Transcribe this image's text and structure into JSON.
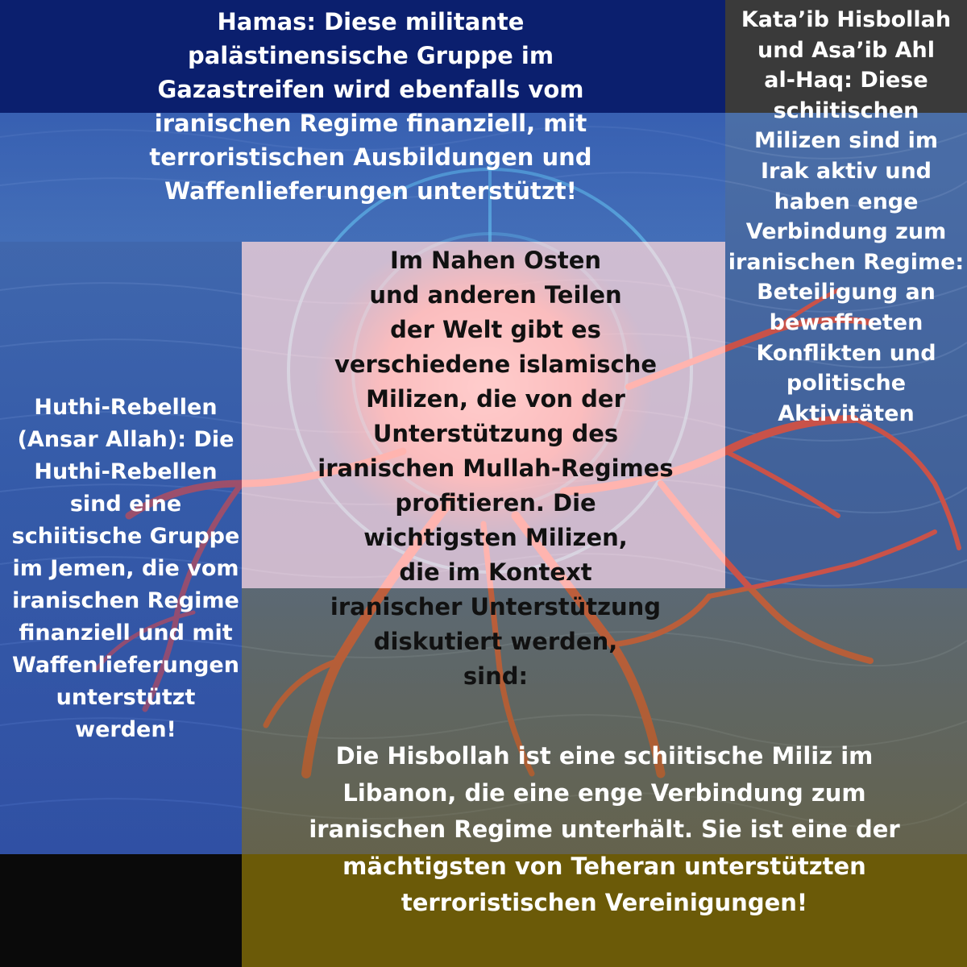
{
  "hamas": {
    "text": "Hamas: Diese militante\npalästinensische Gruppe im\nGazastreifen wird ebenfalls vom\niranischen Regime finanziell, mit\nterroristischen Ausbildungen und\nWaffenlieferungen unterstützt!"
  },
  "kataib": {
    "text": "Kata’ib Hisbollah\nund Asa’ib Ahl\nal-Haq: Diese\nschiitischen\nMilizen sind im\nIrak aktiv und\nhaben enge\nVerbindung zum\niranischen Regime:\nBeteiligung an\nbewaffneten\nKonflikten und\npolitische Aktivitäten"
  },
  "intro": {
    "text": "Im Nahen Osten\nund anderen Teilen\nder Welt gibt es\nverschiedene islamische\nMilizen, die von der\nUnterstützung des\niranischen Mullah-Regimes\nprofitieren. Die\nwichtigsten Milizen,\ndie im Kontext\niranischer Unterstützung\ndiskutiert werden,\nsind:"
  },
  "huthi": {
    "text": "Huthi-Rebellen\n(Ansar Allah): Die\nHuthi-Rebellen\nsind eine\nschiitische Gruppe\nim Jemen, die vom\niranischen Regime\nfinanziell und mit\nWaffenlieferungen\nunterstützt\nwerden!"
  },
  "hisbollah": {
    "text": "Die Hisbollah ist eine schiitische Miliz im\nLibanon, die eine enge Verbindung zum\niranischen Regime unterhält. Sie ist eine der\nmächtigsten von Teheran unterstützten\nterroristischen Vereinigungen!"
  },
  "colors": {
    "top_panel": "#0b1f6e",
    "right_panel": "#3a3a3a",
    "bottom_panel": "#6b5a08",
    "corner_panel": "#0a0a0a",
    "vessel": "#ff5a3c",
    "crosshair": "#7fe8ff"
  }
}
